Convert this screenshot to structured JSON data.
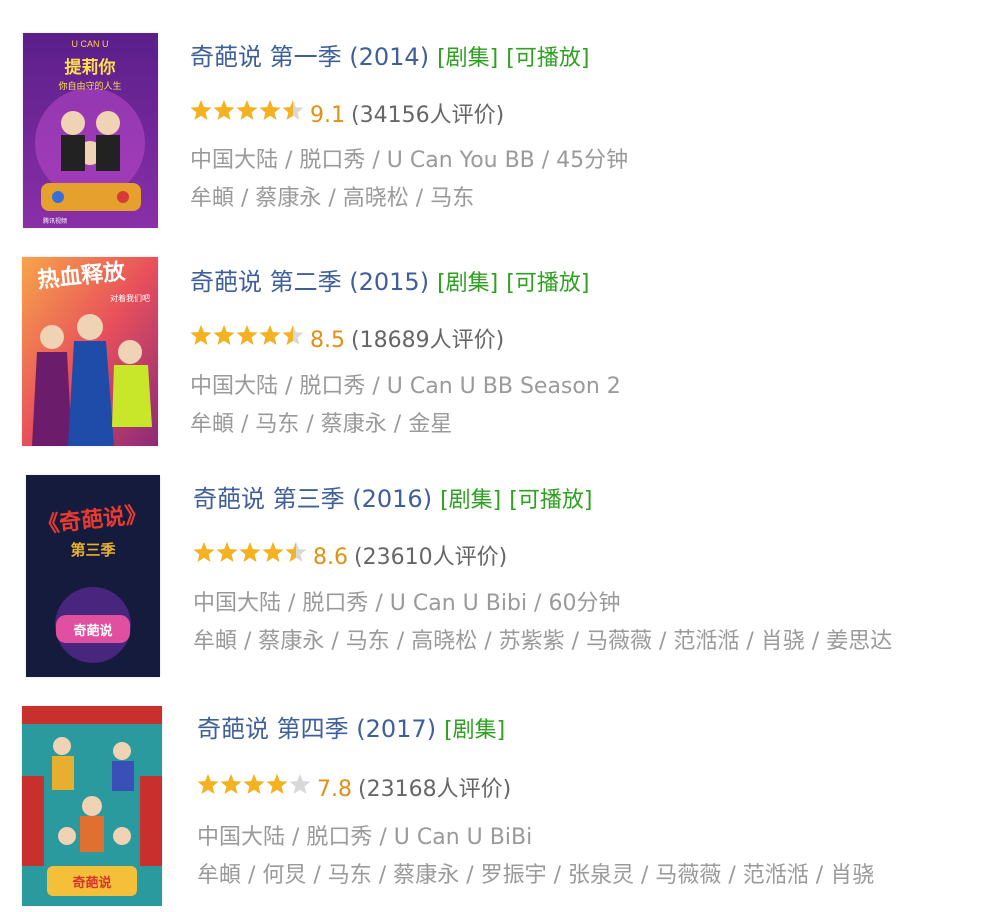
{
  "shows": [
    {
      "title": "奇葩说 第一季 (2014)",
      "tags": [
        "[剧集]",
        "[可播放]"
      ],
      "rating": 9.1,
      "stars": 4.5,
      "score_text": "9.1",
      "votes_text": "(34156人评价)",
      "info": "中国大陆 / 脱口秀 / U Can You BB / 45分钟",
      "cast": "牟頔 / 蔡康永 / 高晓松 / 马东",
      "poster_text": [
        "U CAN U",
        "提莉你",
        "你自由守的人生",
        "腾讯视频"
      ]
    },
    {
      "title": "奇葩说 第二季 (2015)",
      "tags": [
        "[剧集]",
        "[可播放]"
      ],
      "rating": 8.5,
      "stars": 4.5,
      "score_text": "8.5",
      "votes_text": "(18689人评价)",
      "info": "中国大陆 / 脱口秀 / U Can U BB Season 2",
      "cast": "牟頔 / 马东 / 蔡康永 / 金星",
      "poster_text": [
        "热血释放",
        "对着我们吧"
      ]
    },
    {
      "title": "奇葩说 第三季 (2016)",
      "tags": [
        "[剧集]",
        "[可播放]"
      ],
      "rating": 8.6,
      "stars": 4.5,
      "score_text": "8.6",
      "votes_text": "(23610人评价)",
      "info": "中国大陆 / 脱口秀 / U Can U Bibi / 60分钟",
      "cast": "牟頔 / 蔡康永 / 马东 / 高晓松 / 苏紫紫 / 马薇薇 / 范湉湉 / 肖骁 / 姜思达",
      "poster_text": [
        "《奇葩说》",
        "第三季",
        "奇葩说"
      ]
    },
    {
      "title": "奇葩说 第四季 (2017)",
      "tags": [
        "[剧集]"
      ],
      "rating": 7.8,
      "stars": 4,
      "score_text": "7.8",
      "votes_text": "(23168人评价)",
      "info": "中国大陆 / 脱口秀 / U Can U BiBi",
      "cast": "牟頔 / 何炅 / 马东 / 蔡康永 / 罗振宇 / 张泉灵 / 马薇薇 / 范湉湉 / 肖骁",
      "poster_text": [
        "奇葩说"
      ]
    }
  ],
  "colors": {
    "title": "#3f5f9b",
    "tag": "#2ea121",
    "score": "#e09015",
    "star_on": "#f5b21f",
    "star_off": "#d8d8d8",
    "meta": "#9a9a9a"
  }
}
